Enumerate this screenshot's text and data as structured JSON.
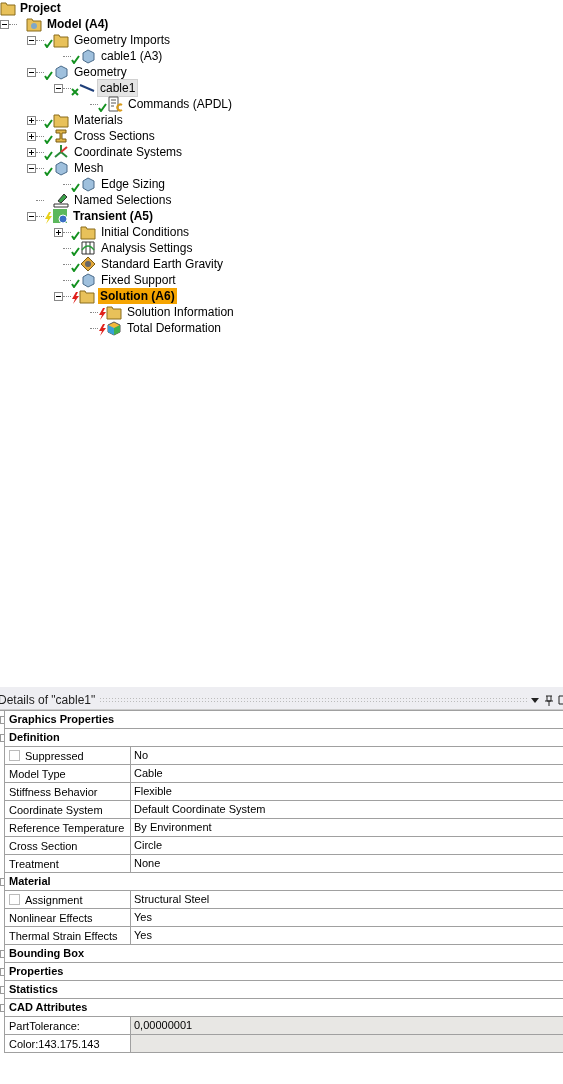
{
  "tree": {
    "root": {
      "label": "Project",
      "kind": "folder"
    },
    "nodes": [
      {
        "label": "Model (A4)",
        "kind": "model",
        "bold": true,
        "expanded": true,
        "selected": false,
        "hovered": false,
        "children": [
          {
            "label": "Geometry Imports",
            "kind": "folder",
            "bold": false,
            "status": {
              "kind": "check"
            },
            "expanded": true,
            "selected": false,
            "hovered": false,
            "children": [
              {
                "label": "cable1 (A3)",
                "kind": "part",
                "bold": false,
                "status": {
                  "kind": "check"
                },
                "selected": false,
                "hovered": false
              }
            ]
          },
          {
            "label": "Geometry",
            "kind": "part",
            "bold": false,
            "status": {
              "kind": "check"
            },
            "expanded": true,
            "selected": false,
            "hovered": false,
            "children": [
              {
                "label": "cable1",
                "kind": "line",
                "bold": false,
                "status": {
                  "kind": "cross"
                },
                "expanded": true,
                "selected": false,
                "hovered": true,
                "children": [
                  {
                    "label": "Commands (APDL)",
                    "kind": "commands",
                    "bold": false,
                    "status": {
                      "kind": "check"
                    },
                    "selected": false,
                    "hovered": false
                  }
                ]
              }
            ]
          },
          {
            "label": "Materials",
            "kind": "folder",
            "bold": false,
            "status": {
              "kind": "check"
            },
            "expanded": false,
            "selected": false,
            "hovered": false
          },
          {
            "label": "Cross Sections",
            "kind": "beam",
            "bold": false,
            "status": {
              "kind": "check"
            },
            "expanded": false,
            "selected": false,
            "hovered": false
          },
          {
            "label": "Coordinate Systems",
            "kind": "axes",
            "bold": false,
            "status": {
              "kind": "check"
            },
            "expanded": false,
            "selected": false,
            "hovered": false
          },
          {
            "label": "Mesh",
            "kind": "part",
            "bold": false,
            "status": {
              "kind": "check"
            },
            "expanded": true,
            "selected": false,
            "hovered": false,
            "children": [
              {
                "label": "Edge Sizing",
                "kind": "part",
                "bold": false,
                "status": {
                  "kind": "check"
                },
                "selected": false,
                "hovered": false
              }
            ]
          },
          {
            "label": "Named Selections",
            "kind": "selection",
            "bold": false,
            "selected": false,
            "hovered": false
          },
          {
            "label": "Transient (A5)",
            "kind": "analysis",
            "bold": true,
            "status": {
              "kind": "bolt-yellow"
            },
            "expanded": true,
            "selected": false,
            "hovered": false,
            "children": [
              {
                "label": "Initial Conditions",
                "kind": "folder",
                "bold": false,
                "status": {
                  "kind": "check"
                },
                "expanded": false,
                "selected": false,
                "hovered": false
              },
              {
                "label": "Analysis Settings",
                "kind": "settings",
                "bold": false,
                "status": {
                  "kind": "check"
                },
                "selected": false,
                "hovered": false
              },
              {
                "label": "Standard Earth Gravity",
                "kind": "gravity",
                "bold": false,
                "status": {
                  "kind": "check"
                },
                "selected": false,
                "hovered": false
              },
              {
                "label": "Fixed Support",
                "kind": "part",
                "bold": false,
                "status": {
                  "kind": "check"
                },
                "selected": false,
                "hovered": false
              },
              {
                "label": "Solution (A6)",
                "kind": "folder",
                "bold": true,
                "status": {
                  "kind": "bolt-red"
                },
                "expanded": true,
                "selected": true,
                "hovered": false,
                "children": [
                  {
                    "label": "Solution Information",
                    "kind": "folder",
                    "bold": false,
                    "status": {
                      "kind": "bolt-red"
                    },
                    "selected": false,
                    "hovered": false
                  },
                  {
                    "label": "Total Deformation",
                    "kind": "result",
                    "bold": false,
                    "status": {
                      "kind": "bolt-red"
                    },
                    "selected": false,
                    "hovered": false
                  }
                ]
              }
            ]
          }
        ]
      }
    ]
  },
  "details": {
    "title": "Details of \"cable1\"",
    "rows": [
      {
        "kind": "category",
        "label": "Graphics Properties"
      },
      {
        "kind": "category",
        "label": "Definition"
      },
      {
        "kind": "property",
        "label": "Suppressed",
        "value": "No",
        "checkbox": {
          "checked": false
        }
      },
      {
        "kind": "property",
        "label": "Model Type",
        "value": "Cable"
      },
      {
        "kind": "property",
        "label": "Stiffness Behavior",
        "value": "Flexible"
      },
      {
        "kind": "property",
        "label": "Coordinate System",
        "value": "Default Coordinate System"
      },
      {
        "kind": "property",
        "label": "Reference Temperature",
        "value": "By Environment"
      },
      {
        "kind": "property",
        "label": "Cross Section",
        "value": "Circle"
      },
      {
        "kind": "property",
        "label": "Treatment",
        "value": "None"
      },
      {
        "kind": "category",
        "label": "Material"
      },
      {
        "kind": "property",
        "label": "Assignment",
        "value": "Structural Steel",
        "checkbox": {
          "checked": false
        }
      },
      {
        "kind": "property",
        "label": "Nonlinear Effects",
        "value": "Yes"
      },
      {
        "kind": "property",
        "label": "Thermal Strain Effects",
        "value": "Yes"
      },
      {
        "kind": "category",
        "label": "Bounding Box"
      },
      {
        "kind": "category",
        "label": "Properties"
      },
      {
        "kind": "category",
        "label": "Statistics"
      },
      {
        "kind": "category",
        "label": "CAD Attributes"
      },
      {
        "kind": "readonly",
        "label": "PartTolerance:",
        "value": "0,00000001"
      },
      {
        "kind": "readonly",
        "label": "Color:143.175.143"
      }
    ]
  }
}
